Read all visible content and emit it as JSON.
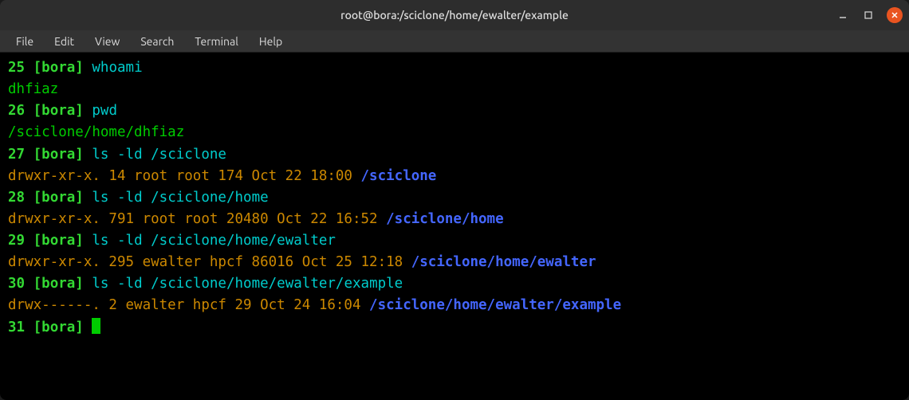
{
  "titlebar": {
    "title": "root@bora:/sciclone/home/ewalter/example"
  },
  "menubar": {
    "items": [
      "File",
      "Edit",
      "View",
      "Search",
      "Terminal",
      "Help"
    ]
  },
  "lines": [
    {
      "type": "cmd",
      "num": "25",
      "host": "[bora]",
      "cmd": "whoami"
    },
    {
      "type": "out-green",
      "text": "dhfiaz"
    },
    {
      "type": "cmd",
      "num": "26",
      "host": "[bora]",
      "cmd": "pwd"
    },
    {
      "type": "out-green",
      "text": "/sciclone/home/dhfiaz"
    },
    {
      "type": "cmd",
      "num": "27",
      "host": "[bora]",
      "cmd": "ls -ld /sciclone"
    },
    {
      "type": "ls",
      "attrs": "drwxr-xr-x. 14 root root 174 Oct 22 18:00 ",
      "path": "/sciclone"
    },
    {
      "type": "cmd",
      "num": "28",
      "host": "[bora]",
      "cmd": "ls -ld /sciclone/home"
    },
    {
      "type": "ls",
      "attrs": "drwxr-xr-x. 791 root root 20480 Oct 22 16:52 ",
      "path": "/sciclone/home"
    },
    {
      "type": "cmd",
      "num": "29",
      "host": "[bora]",
      "cmd": "ls -ld /sciclone/home/ewalter"
    },
    {
      "type": "ls",
      "attrs": "drwxr-xr-x. 295 ewalter hpcf 86016 Oct 25 12:18 ",
      "path": "/sciclone/home/ewalter"
    },
    {
      "type": "cmd",
      "num": "30",
      "host": "[bora]",
      "cmd": "ls -ld /sciclone/home/ewalter/example"
    },
    {
      "type": "ls",
      "attrs": "drwx------. 2 ewalter hpcf 29 Oct 24 16:04 ",
      "path": "/sciclone/home/ewalter/example"
    },
    {
      "type": "prompt-cursor",
      "num": "31",
      "host": "[bora]"
    }
  ]
}
